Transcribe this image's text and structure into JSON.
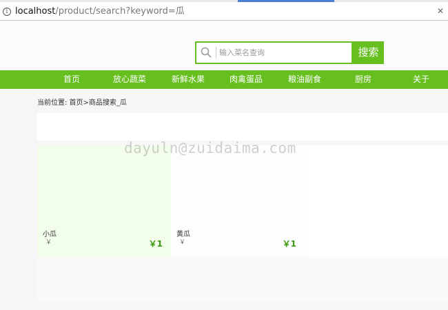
{
  "browser": {
    "url_host": "localhost",
    "url_path": "/product/search?keyword=瓜",
    "close_glyph": "✕"
  },
  "header": {
    "search_placeholder": "输入菜名查询",
    "search_button": "搜索"
  },
  "nav": {
    "items": [
      "首页",
      "放心蔬菜",
      "新鲜水果",
      "肉禽蛋品",
      "粮油副食",
      "厨房",
      "关于"
    ]
  },
  "breadcrumb": "当前位置: 首页>商品搜索_瓜",
  "products": [
    {
      "name": "小瓜",
      "yen": "￥",
      "price": "￥1"
    },
    {
      "name": "黄瓜",
      "yen": "￥",
      "price": "￥1"
    }
  ],
  "watermark": "dayuln@zuidaima.com",
  "colors": {
    "brand_green": "#66bf1f",
    "price_green": "#3d9a12"
  }
}
